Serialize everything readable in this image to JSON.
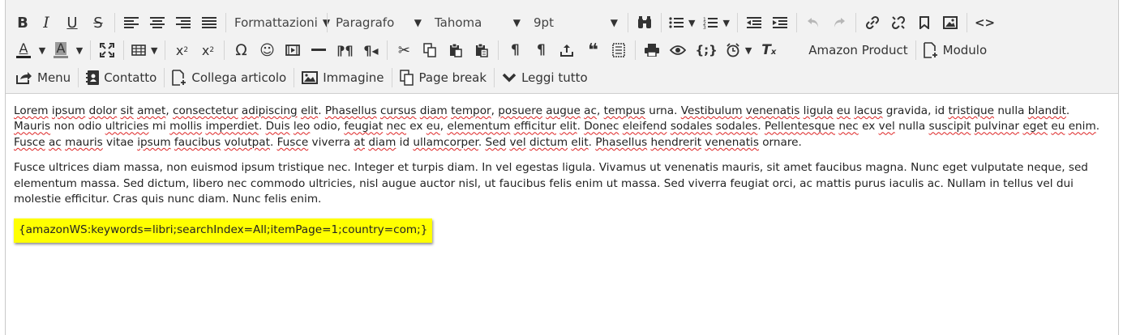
{
  "toolbar": {
    "format_menu": "Formattazioni",
    "block_format": "Paragrafo",
    "font_family": "Tahoma",
    "font_size": "9pt",
    "amazon_product": "Amazon Product",
    "form_module": "Modulo",
    "menu": "Menu",
    "contact": "Contatto",
    "link_article": "Collega articolo",
    "image": "Immagine",
    "page_break": "Page break",
    "read_more": "Leggi tutto",
    "subscript_glyph": "x",
    "subscript_index": "2",
    "superscript_glyph": "x",
    "superscript_index": "2",
    "text_color_letter": "A",
    "bg_color_letter": "A",
    "text_color": "#222222",
    "bg_color": "#888888"
  },
  "content": {
    "paragraph1": [
      {
        "t": "Lorem",
        "s": true
      },
      {
        "t": " "
      },
      {
        "t": "ipsum",
        "s": true
      },
      {
        "t": " "
      },
      {
        "t": "dolor",
        "s": true
      },
      {
        "t": " "
      },
      {
        "t": "sit",
        "s": true
      },
      {
        "t": " "
      },
      {
        "t": "amet",
        "s": true
      },
      {
        "t": ", "
      },
      {
        "t": "consectetur",
        "s": true
      },
      {
        "t": " "
      },
      {
        "t": "adipiscing",
        "s": true
      },
      {
        "t": " "
      },
      {
        "t": "elit",
        "s": true
      },
      {
        "t": ". "
      },
      {
        "t": "Phasellus",
        "s": true
      },
      {
        "t": " "
      },
      {
        "t": "cursus",
        "s": true
      },
      {
        "t": " "
      },
      {
        "t": "diam",
        "s": true
      },
      {
        "t": " "
      },
      {
        "t": "tempor",
        "s": true
      },
      {
        "t": ", "
      },
      {
        "t": "posuere",
        "s": true
      },
      {
        "t": " "
      },
      {
        "t": "augue",
        "s": true
      },
      {
        "t": " "
      },
      {
        "t": "ac",
        "s": true
      },
      {
        "t": ", "
      },
      {
        "t": "tempus",
        "s": true
      },
      {
        "t": " urna. "
      },
      {
        "t": "Vestibulum",
        "s": true
      },
      {
        "t": " "
      },
      {
        "t": "venenatis",
        "s": true
      },
      {
        "t": " "
      },
      {
        "t": "ligula",
        "s": true
      },
      {
        "t": " "
      },
      {
        "t": "eu",
        "s": true
      },
      {
        "t": " "
      },
      {
        "t": "lacus",
        "s": true
      },
      {
        "t": " gravida, id "
      },
      {
        "t": "tristique",
        "s": true
      },
      {
        "t": " nulla "
      },
      {
        "t": "blandit",
        "s": true
      },
      {
        "t": ". "
      },
      {
        "t": "Mauris",
        "s": true
      },
      {
        "t": " non odio "
      },
      {
        "t": "ultricies",
        "s": true
      },
      {
        "t": " mi "
      },
      {
        "t": "mollis",
        "s": true
      },
      {
        "t": " "
      },
      {
        "t": "imperdiet",
        "s": true
      },
      {
        "t": ". "
      },
      {
        "t": "Duis",
        "s": true
      },
      {
        "t": " "
      },
      {
        "t": "leo",
        "s": true
      },
      {
        "t": " odio, "
      },
      {
        "t": "feugiat",
        "s": true
      },
      {
        "t": " "
      },
      {
        "t": "nec",
        "s": true
      },
      {
        "t": " ex "
      },
      {
        "t": "eu",
        "s": true
      },
      {
        "t": ", "
      },
      {
        "t": "elementum",
        "s": true
      },
      {
        "t": " "
      },
      {
        "t": "efficitur",
        "s": true
      },
      {
        "t": " "
      },
      {
        "t": "elit",
        "s": true
      },
      {
        "t": ". "
      },
      {
        "t": "Donec",
        "s": true
      },
      {
        "t": " "
      },
      {
        "t": "eleifend",
        "s": true
      },
      {
        "t": " "
      },
      {
        "t": "sodales",
        "s": true
      },
      {
        "t": " "
      },
      {
        "t": "sodales",
        "s": true
      },
      {
        "t": ". "
      },
      {
        "t": "Pellentesque",
        "s": true
      },
      {
        "t": " "
      },
      {
        "t": "nec",
        "s": true
      },
      {
        "t": " ex "
      },
      {
        "t": "vel",
        "s": true
      },
      {
        "t": " nulla "
      },
      {
        "t": "suscipit",
        "s": true
      },
      {
        "t": " "
      },
      {
        "t": "pulvinar",
        "s": true
      },
      {
        "t": " "
      },
      {
        "t": "eget",
        "s": true
      },
      {
        "t": " "
      },
      {
        "t": "eu",
        "s": true
      },
      {
        "t": " "
      },
      {
        "t": "enim",
        "s": true
      },
      {
        "t": ". "
      },
      {
        "t": "Fusce",
        "s": true
      },
      {
        "t": " "
      },
      {
        "t": "ac",
        "s": true
      },
      {
        "t": " "
      },
      {
        "t": "mauris",
        "s": true
      },
      {
        "t": " vitae "
      },
      {
        "t": "ipsum",
        "s": true
      },
      {
        "t": " "
      },
      {
        "t": "faucibus",
        "s": true
      },
      {
        "t": " "
      },
      {
        "t": "volutpat",
        "s": true
      },
      {
        "t": ". "
      },
      {
        "t": "Fusce",
        "s": true
      },
      {
        "t": " viverra "
      },
      {
        "t": "at",
        "s": true
      },
      {
        "t": " "
      },
      {
        "t": "diam",
        "s": true
      },
      {
        "t": " id "
      },
      {
        "t": "ullamcorper",
        "s": true
      },
      {
        "t": ". "
      },
      {
        "t": "Sed",
        "s": true
      },
      {
        "t": " "
      },
      {
        "t": "vel",
        "s": true
      },
      {
        "t": " "
      },
      {
        "t": "dictum",
        "s": true
      },
      {
        "t": " "
      },
      {
        "t": "elit",
        "s": true
      },
      {
        "t": ". "
      },
      {
        "t": "Phasellus",
        "s": true
      },
      {
        "t": " "
      },
      {
        "t": "hendrerit",
        "s": true
      },
      {
        "t": " "
      },
      {
        "t": "venenatis",
        "s": true
      },
      {
        "t": " ornare."
      }
    ],
    "paragraph2": "Fusce ultrices diam massa, non euismod ipsum tristique nec. Integer et turpis diam. In vel egestas ligula. Vivamus ut venenatis mauris, sit amet faucibus magna. Nunc eget vulputate neque, sed elementum massa. Sed dictum, libero nec commodo ultricies, nisl augue auctor nisl, ut faucibus felis enim ut massa. Sed viverra feugiat orci, ac mattis purus iaculis ac. Nullam in tellus vel dui molestie efficitur. Cras quis nunc diam. Nunc felis enim.",
    "shortcode": "{amazonWS:keywords=libri;searchIndex=All;itemPage=1;country=com;}",
    "shortcode_highlight": "#ffff00"
  }
}
